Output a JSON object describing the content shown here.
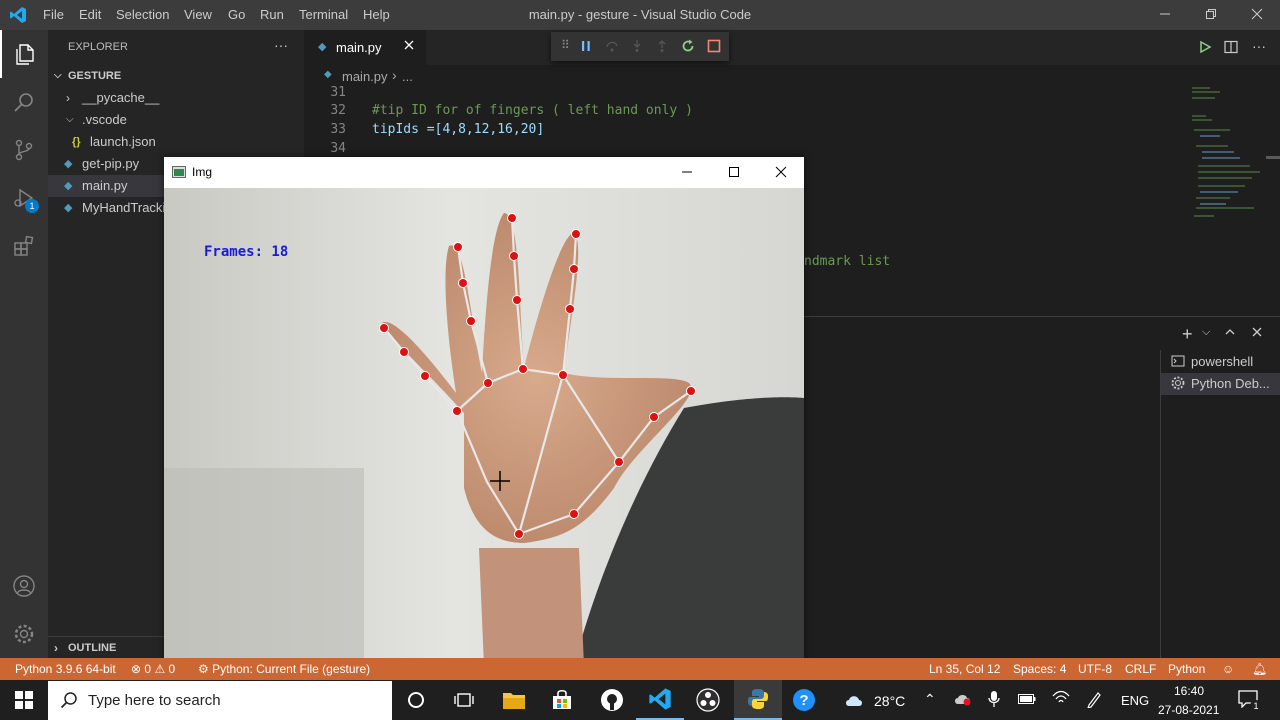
{
  "window": {
    "title": "main.py - gesture - Visual Studio Code",
    "menu": [
      "File",
      "Edit",
      "Selection",
      "View",
      "Go",
      "Run",
      "Terminal",
      "Help"
    ]
  },
  "sidebar": {
    "header": "EXPLORER",
    "more": "···",
    "folder": "GESTURE",
    "items": [
      {
        "label": "__pycache__"
      },
      {
        "label": ".vscode"
      },
      {
        "label": "launch.json",
        "icon": "{}"
      },
      {
        "label": "get-pip.py"
      },
      {
        "label": "main.py"
      },
      {
        "label": "MyHandTracki"
      }
    ],
    "outline": "OUTLINE"
  },
  "activity": {
    "debug_badge": "1"
  },
  "editor": {
    "tab": "main.py",
    "breadcrumb_file": "main.py",
    "breadcrumb_rest": "...",
    "lines": [
      {
        "num": "31",
        "text": ""
      },
      {
        "num": "32",
        "text": "#tip ID for of fingers ( left hand only )"
      },
      {
        "num": "33",
        "text": "tipIds =[4,8,12,16,20]"
      },
      {
        "num": "34",
        "text": ""
      }
    ],
    "obscured_text": "ndmark list"
  },
  "panel": {
    "terminals": [
      "powershell",
      "Python Deb..."
    ]
  },
  "img_window": {
    "title": "Img",
    "frames_label": "Frames: 18"
  },
  "statusbar": {
    "python": "Python 3.9.6 64-bit",
    "errors": "0",
    "warnings": "0",
    "debug_config": "Python: Current File (gesture)",
    "position": "Ln 35, Col 12",
    "spaces": "Spaces: 4",
    "encoding": "UTF-8",
    "eol": "CRLF",
    "language": "Python",
    "color": "#cc6633"
  },
  "taskbar": {
    "search_placeholder": "Type here to search",
    "temperature": "28°C",
    "language": "ENG",
    "time": "16:40",
    "date": "27-08-2021",
    "notification_count": "1"
  }
}
